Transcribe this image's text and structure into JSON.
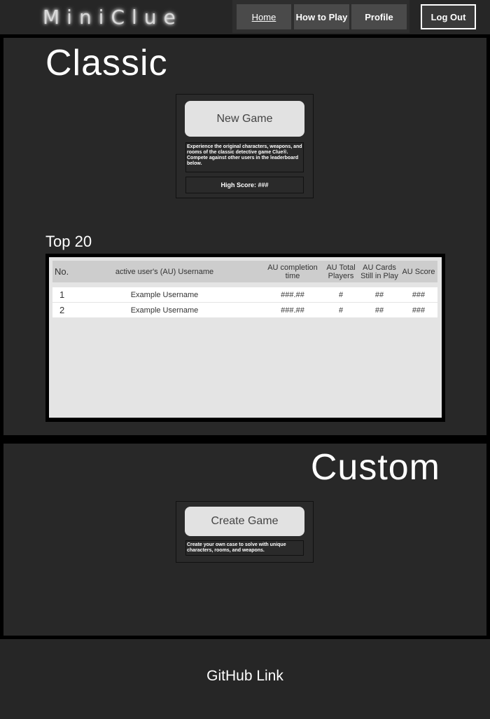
{
  "header": {
    "logo": "MiniClue",
    "nav": {
      "home": "Home",
      "how_to_play": "How to Play",
      "profile": "Profile"
    },
    "logout": "Log Out"
  },
  "classic": {
    "title": "Classic",
    "button": "New Game",
    "description": "Experience the original characters, weapons, and rooms of the classic detective game Clue®. Compete against other users in the leaderboard  below.",
    "high_score": "High Score: ###"
  },
  "leaderboard": {
    "title": "Top 20",
    "headers": {
      "no": "No.",
      "username": "active user's (AU) Username",
      "time": "AU completion time",
      "players": "AU Total Players",
      "cards": "AU Cards Still in Play",
      "score": "AU Score"
    },
    "rows": [
      {
        "no": "1",
        "username": "Example Username",
        "time": "###.##",
        "players": "#",
        "cards": "##",
        "score": "###"
      },
      {
        "no": "2",
        "username": "Example Username",
        "time": "###.##",
        "players": "#",
        "cards": "##",
        "score": "###"
      }
    ]
  },
  "custom": {
    "title": "Custom",
    "button": "Create Game",
    "description": "Create your own case to solve with unique characters, rooms, and weapons."
  },
  "footer": {
    "github": "GitHub Link"
  }
}
